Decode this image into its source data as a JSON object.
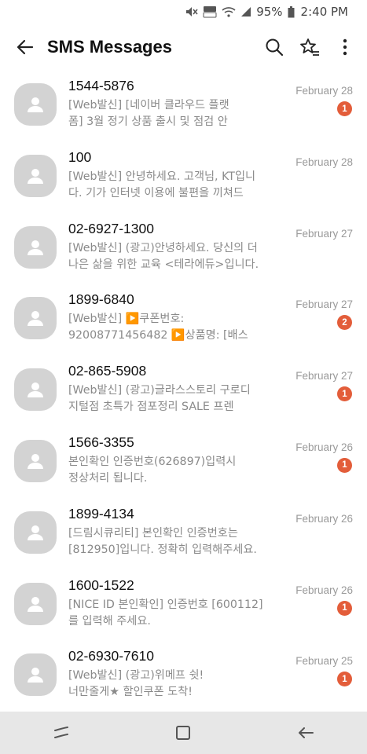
{
  "status_bar": {
    "battery": "95%",
    "time": "2:40 PM",
    "icons": [
      "mute-icon",
      "volte-icon",
      "wifi-icon",
      "signal-icon",
      "battery-icon"
    ]
  },
  "app_bar": {
    "title": "SMS Messages",
    "icons": [
      "back-arrow-icon",
      "search-icon",
      "star-list-icon",
      "more-vert-icon"
    ]
  },
  "messages": [
    {
      "sender": "1544-5876",
      "preview": "[Web발신] [네이버 클라우드 플랫\n폼] 3월 정기 상품 출시 및 점검 안",
      "date": "February 28",
      "unread": "1"
    },
    {
      "sender": "100",
      "preview": "[Web발신] 안녕하세요. 고객님, KT입니\n다.  기가 인터넷 이용에 불편을 끼쳐드",
      "date": "February 28",
      "unread": ""
    },
    {
      "sender": "02-6927-1300",
      "preview": "[Web발신] (광고)안녕하세요. 당신의 더\n나은 삶을 위한 교육 <테라에듀>입니다.",
      "date": "February 27",
      "unread": ""
    },
    {
      "sender": "1899-6840",
      "preview": "[Web발신]   ▶️쿠폰번호:\n92008771456482 ▶️상품명: [배스",
      "date": "February 27",
      "unread": "2"
    },
    {
      "sender": "02-865-5908",
      "preview": "[Web발신] (광고)글라스스토리  구로디\n지털점    초특가  점포정리 SALE    프렌",
      "date": "February 27",
      "unread": "1"
    },
    {
      "sender": "1566-3355",
      "preview": "본인확인 인증번호(626897)입력시\n정상처리 됩니다.",
      "date": "February 26",
      "unread": "1"
    },
    {
      "sender": "1899-4134",
      "preview": "[드림시큐리티] 본인확인 인증번호는\n[812950]입니다. 정확히 입력해주세요.",
      "date": "February 26",
      "unread": ""
    },
    {
      "sender": "1600-1522",
      "preview": "[NICE ID 본인확인] 인증번호 [600112]\n를 입력해 주세요.",
      "date": "February 26",
      "unread": "1"
    },
    {
      "sender": "02-6930-7610",
      "preview": "[Web발신] (광고)위메프 쉿!\n너만줄게★ 할인쿠폰 도착!",
      "date": "February 25",
      "unread": "1"
    }
  ],
  "nav_bar": {
    "icons": [
      "recents-icon",
      "home-icon",
      "back-nav-icon"
    ]
  },
  "colors": {
    "badge": "#e35d3a",
    "avatar_bg": "#d3d3d3",
    "nav_bg": "#e7e7e7"
  }
}
